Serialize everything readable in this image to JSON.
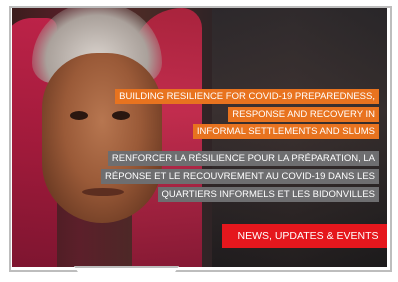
{
  "hero": {
    "image": "photo-of-elderly-woman-in-red-headscarf",
    "english_lines": [
      "BUILDING RESILIENCE FOR COVID-19 PREPAREDNESS,",
      "RESPONSE AND RECOVERY IN",
      "INFORMAL SETTLEMENTS AND SLUMS"
    ],
    "french_lines": [
      "RENFORCER LA RÉSILIENCE POUR LA PRÉPARATION, LA",
      "RÉPONSE ET LE RECOUVREMENT AU COVID-19 DANS LES",
      "QUARTIERS INFORMELS ET LES BIDONVILLES"
    ],
    "cta_label": "NEWS, UPDATES & EVENTS"
  },
  "colors": {
    "english_highlight": "#e8731f",
    "french_highlight": "#6e6e70",
    "cta": "#e5171d"
  }
}
